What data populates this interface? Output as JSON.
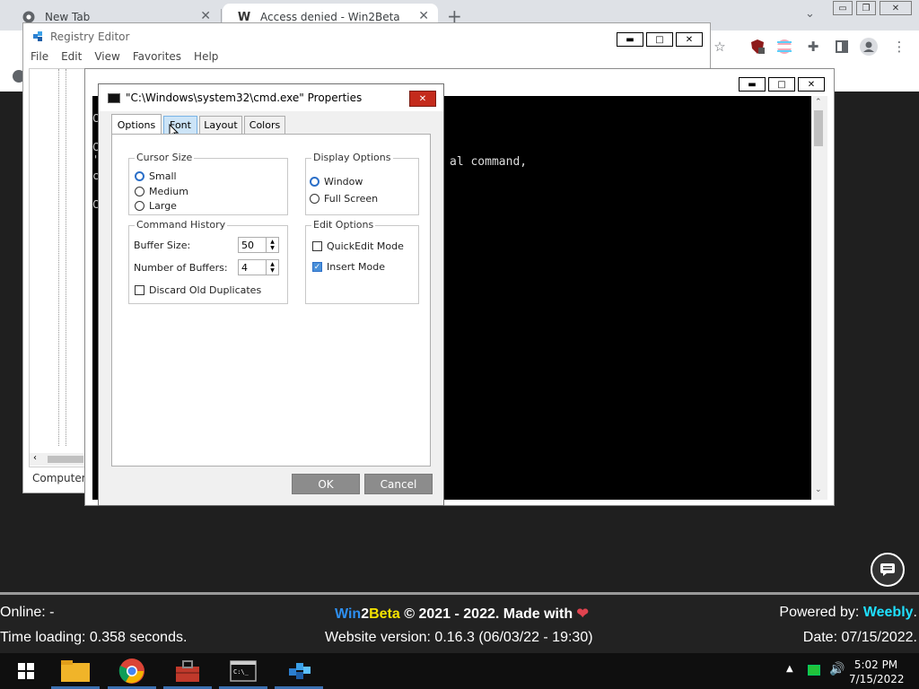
{
  "browser": {
    "tabs": [
      {
        "title": "New Tab",
        "icon": "chrome-icon"
      },
      {
        "title": "Access denied - Win2Beta",
        "icon": "weebly-icon"
      }
    ]
  },
  "regedit": {
    "title": "Registry Editor",
    "menu": [
      "File",
      "Edit",
      "View",
      "Favorites",
      "Help"
    ],
    "status": "Computer\\"
  },
  "cmd": {
    "visible_text": "al command,",
    "prompt_chars": [
      "C",
      "C",
      "'",
      "c",
      "C"
    ]
  },
  "props": {
    "title": "\"C:\\Windows\\system32\\cmd.exe\" Properties",
    "tabs": [
      "Options",
      "Font",
      "Layout",
      "Colors"
    ],
    "cursor_size": {
      "legend": "Cursor Size",
      "options": [
        "Small",
        "Medium",
        "Large"
      ],
      "selected": "Small"
    },
    "display_options": {
      "legend": "Display Options",
      "options": [
        "Window",
        "Full Screen"
      ],
      "selected": "Window"
    },
    "command_history": {
      "legend": "Command History",
      "buffer_size_label": "Buffer Size:",
      "buffer_size": "50",
      "num_buffers_label": "Number of Buffers:",
      "num_buffers": "4",
      "discard_label": "Discard Old Duplicates"
    },
    "edit_options": {
      "legend": "Edit Options",
      "quickedit": "QuickEdit Mode",
      "insert": "Insert Mode"
    },
    "ok": "OK",
    "cancel": "Cancel"
  },
  "footer": {
    "online": "Online: -",
    "time_loading": "Time loading: 0.358 seconds.",
    "brand_win": "Win",
    "brand_2": "2",
    "brand_beta": "Beta",
    "copyright": " © 2021 - 2022. Made with ",
    "heart": "❤",
    "version": "Website version: 0.16.3 (06/03/22 - 19:30)",
    "powered_label": "Powered by: ",
    "powered_brand": "Weebly",
    "powered_dot": ".",
    "date": "Date: 07/15/2022."
  },
  "taskbar": {
    "time": "5:02 PM",
    "date": "7/15/2022"
  },
  "colors": {
    "win_blue": "#2e8ff0",
    "beta_yellow": "#f5e300",
    "weebly_cyan": "#1fe0ff",
    "heart_red": "#e0434f"
  }
}
